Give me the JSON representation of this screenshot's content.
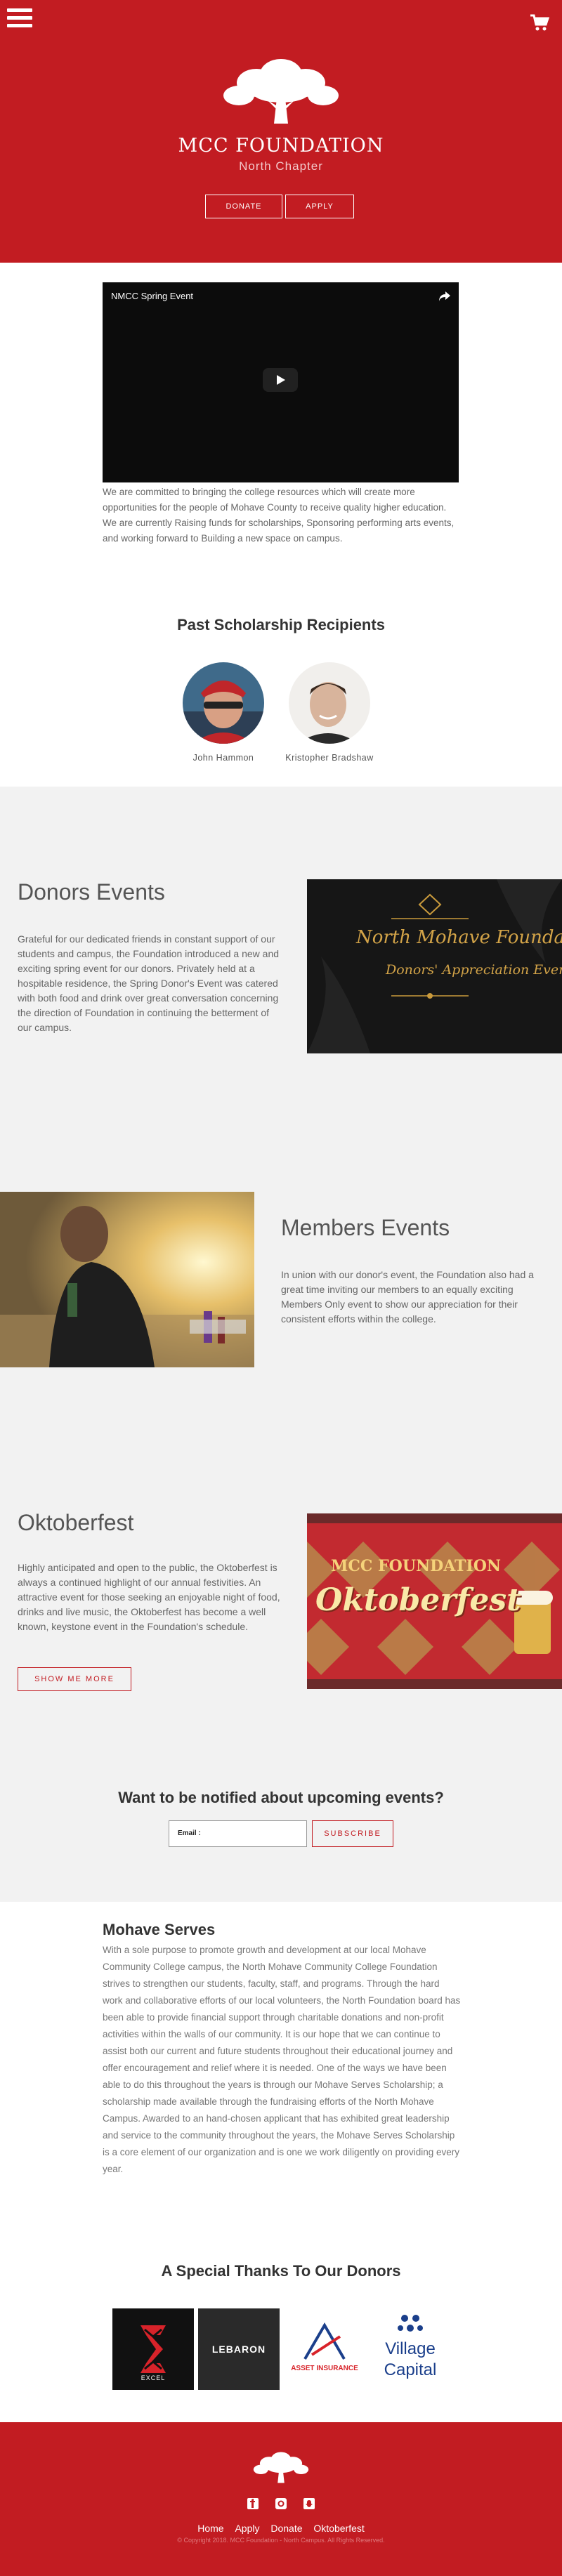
{
  "header": {
    "title": "MCC FOUNDATION",
    "subtitle": "North Chapter",
    "donate_label": "DONATE",
    "apply_label": "APPLY"
  },
  "video": {
    "title": "NMCC Spring Event"
  },
  "intro": "We are committed to bringing the college resources which will create more opportunities for the people of Mohave County to receive quality higher education. We are currently Raising funds for scholarships, Sponsoring performing arts events, and working forward to Building a new space on campus.",
  "scholarship": {
    "title": "Past Scholarship Recipients",
    "recipients": [
      {
        "name": "John Hammon"
      },
      {
        "name": "Kristopher Bradshaw"
      }
    ]
  },
  "donors_events": {
    "title": "Donors Events",
    "text": "Grateful for our dedicated friends in constant support of our students and campus, the Foundation introduced a new and exciting spring event for our donors. Privately held at a hospitable residence, the Spring Donor's Event was catered with both food and drink over great conversation concerning the direction of Foundation in continuing the betterment of our campus.",
    "banner_line1": "North Mohave Foundation",
    "banner_line2": "Donors' Appreciation Event"
  },
  "members_events": {
    "title": "Members Events",
    "text": "In union with our donor's event, the Foundation also had a great time inviting our members to an equally exciting Members Only event to show our appreciation for their consistent efforts within the college."
  },
  "oktoberfest": {
    "title": "Oktoberfest",
    "text": "Highly anticipated and open to the public, the Oktoberfest is always a continued highlight of our annual festivities. An attractive event for those seeking an enjoyable night of food, drinks and live music, the Oktoberfest has become a well known, keystone event in the Foundation's schedule.",
    "button_label": "SHOW ME MORE",
    "banner_top": "MCC FOUNDATION",
    "banner_main": "Oktoberfest"
  },
  "newsletter": {
    "title": "Want to be notified about upcoming events?",
    "email_label": "Email :",
    "subscribe_label": "SUBSCRIBE"
  },
  "serves": {
    "title": "Mohave Serves",
    "text": "With a sole purpose to promote growth and development at our local Mohave Community College campus, the North Mohave Community College Foundation strives to strengthen our students, faculty, staff, and programs. Through the hard work and collaborative efforts of our local volunteers, the North Foundation board has been able to provide financial support through charitable donations and non-profit activities within the walls of our community. It is our hope that we can continue to assist both our current and future students throughout their educational journey and offer encouragement and relief where it is needed. One of the ways we have been able to do this throughout the years is through our Mohave Serves Scholarship; a scholarship made available through the fundraising efforts of the North Mohave Campus. Awarded to an hand-chosen applicant that has exhibited great leadership and service to the community throughout the years, the Mohave Serves Scholarship is a core element of our organization and is one we work diligently on providing every year."
  },
  "donors": {
    "title": "A Special Thanks To Our Donors",
    "logos": [
      {
        "name": "EXCEL",
        "sub": ""
      },
      {
        "name": "LEBARON",
        "sub": ""
      },
      {
        "name": "ASSET INSURANCE",
        "sub": ""
      },
      {
        "name": "Village",
        "sub": "Capital"
      }
    ]
  },
  "footer": {
    "links": [
      "Home",
      "Apply",
      "Donate",
      "Oktoberfest"
    ],
    "copyright": "© Copyright 2018. MCC Foundation - North Campus. All Rights Reserved."
  },
  "colors": {
    "brand_red": "#c21c22",
    "grey_bg": "#f2f2f2"
  }
}
